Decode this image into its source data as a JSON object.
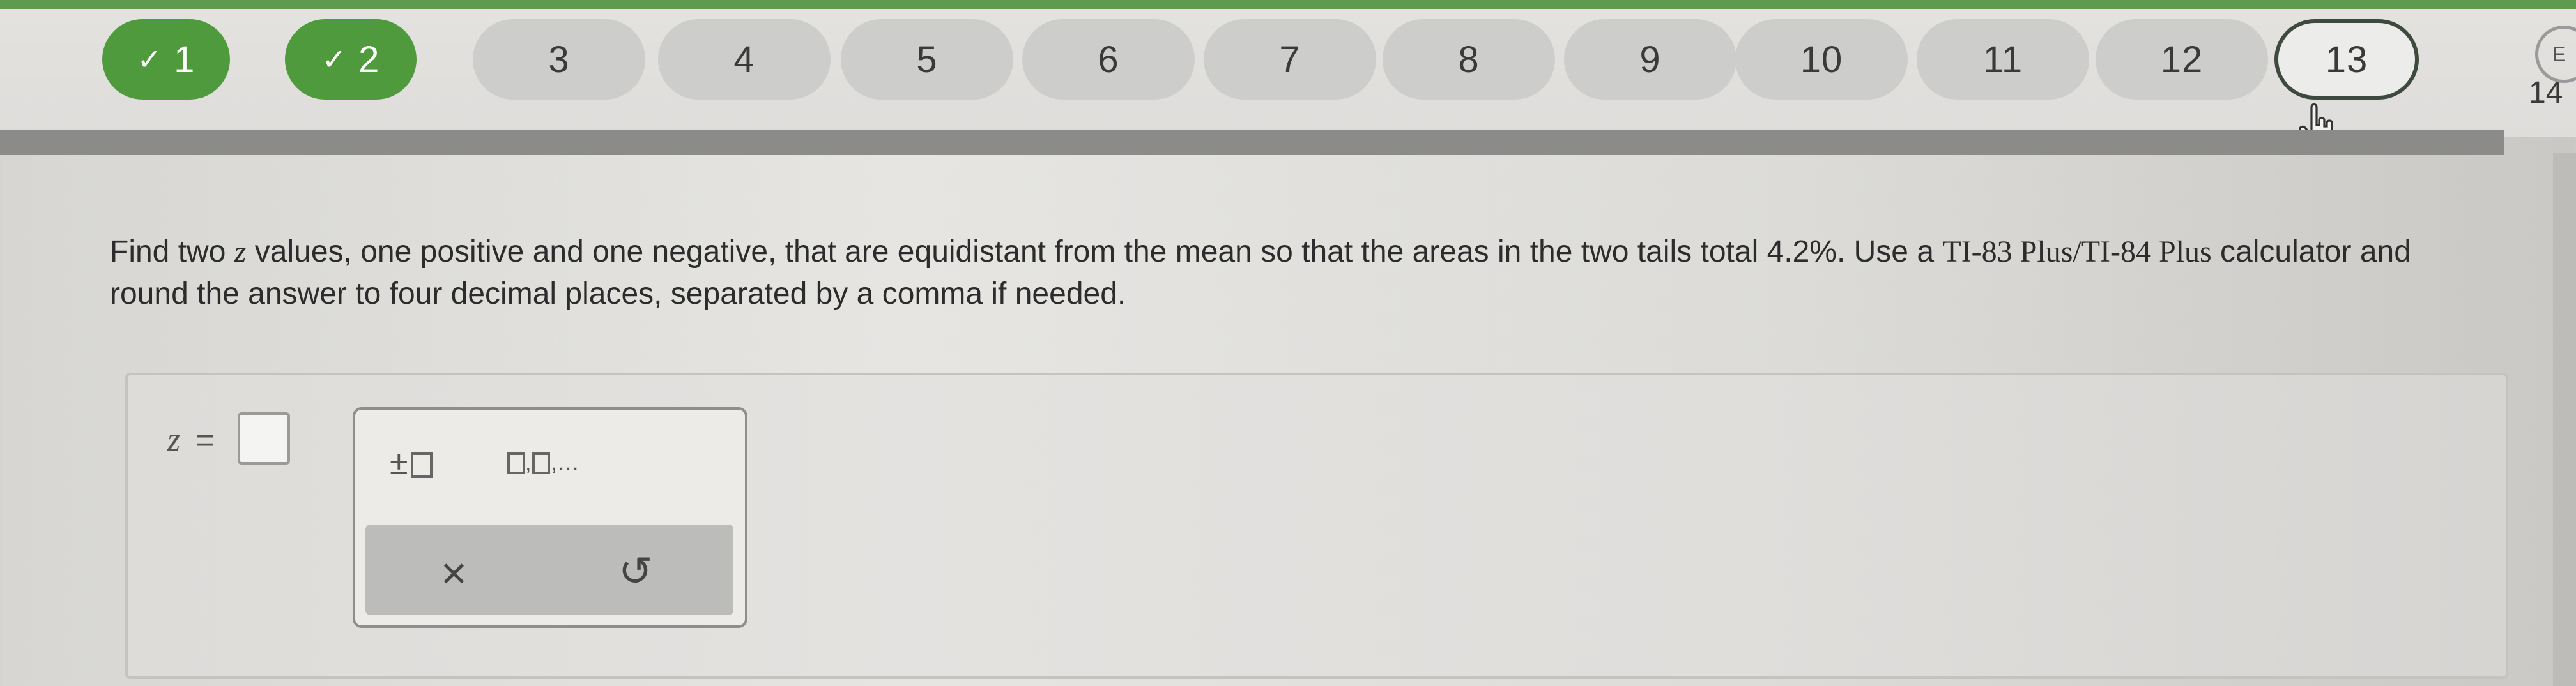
{
  "nav": {
    "questions": [
      {
        "label": "1",
        "status": "done"
      },
      {
        "label": "2",
        "status": "done"
      },
      {
        "label": "3",
        "status": "pending"
      },
      {
        "label": "4",
        "status": "pending"
      },
      {
        "label": "5",
        "status": "pending"
      },
      {
        "label": "6",
        "status": "pending"
      },
      {
        "label": "7",
        "status": "pending"
      },
      {
        "label": "8",
        "status": "pending"
      },
      {
        "label": "9",
        "status": "pending"
      },
      {
        "label": "10",
        "status": "pending"
      },
      {
        "label": "11",
        "status": "pending"
      },
      {
        "label": "12",
        "status": "pending"
      },
      {
        "label": "13",
        "status": "current"
      }
    ],
    "next_label": "14",
    "end_label": "E",
    "check_icon": "✓",
    "colors": {
      "done": "#4f9a3d",
      "pending": "#cdcdcb",
      "current_border": "#3f4a3f"
    }
  },
  "question": {
    "part1": "Find two ",
    "var": "z",
    "part2": " values, one positive and one negative, that are equidistant from the mean so that the areas in the two tails total 4.2%. Use a ",
    "calc": "TI-83 Plus/TI-84 Plus",
    "part3": " calculator and round the answer to four decimal places, separated by a comma if needed."
  },
  "answer": {
    "var": "z",
    "eq": "=",
    "value": ""
  },
  "palette": {
    "plus_minus": "±",
    "list_suffix": ",...",
    "clear_icon": "×",
    "undo_icon": "↺"
  }
}
